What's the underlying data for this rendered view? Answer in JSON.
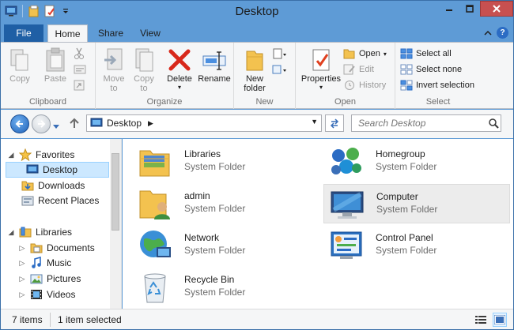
{
  "window": {
    "title": "Desktop"
  },
  "ribbon_tabs": {
    "file": "File",
    "home": "Home",
    "share": "Share",
    "view": "View"
  },
  "ribbon": {
    "clipboard": {
      "label": "Clipboard",
      "copy": "Copy",
      "paste": "Paste"
    },
    "organize": {
      "label": "Organize",
      "move_to": "Move",
      "move_to_2": "to",
      "copy_to": "Copy",
      "copy_to_2": "to",
      "delete": "Delete",
      "rename": "Rename"
    },
    "new": {
      "label": "New",
      "new_folder": "New",
      "new_folder_2": "folder"
    },
    "open": {
      "label": "Open",
      "properties": "Properties",
      "open": "Open",
      "edit": "Edit",
      "history": "History"
    },
    "select": {
      "label": "Select",
      "select_all": "Select all",
      "select_none": "Select none",
      "invert": "Invert selection"
    }
  },
  "address": {
    "location": "Desktop",
    "search_placeholder": "Search Desktop"
  },
  "nav_pane": {
    "favorites": "Favorites",
    "desktop": "Desktop",
    "downloads": "Downloads",
    "recent_places": "Recent Places",
    "libraries": "Libraries",
    "documents": "Documents",
    "music": "Music",
    "pictures": "Pictures",
    "videos": "Videos"
  },
  "files": [
    {
      "name": "Libraries",
      "type": "System Folder"
    },
    {
      "name": "Homegroup",
      "type": "System Folder"
    },
    {
      "name": "admin",
      "type": "System Folder"
    },
    {
      "name": "Computer",
      "type": "System Folder"
    },
    {
      "name": "Network",
      "type": "System Folder"
    },
    {
      "name": "Control Panel",
      "type": "System Folder"
    },
    {
      "name": "Recycle Bin",
      "type": "System Folder"
    }
  ],
  "status": {
    "items": "7 items",
    "selected": "1 item selected"
  },
  "colors": {
    "titlebar": "#5e9bd6",
    "file_tab": "#1f5fa5",
    "selection": "#cce8ff",
    "close": "#c75050"
  }
}
